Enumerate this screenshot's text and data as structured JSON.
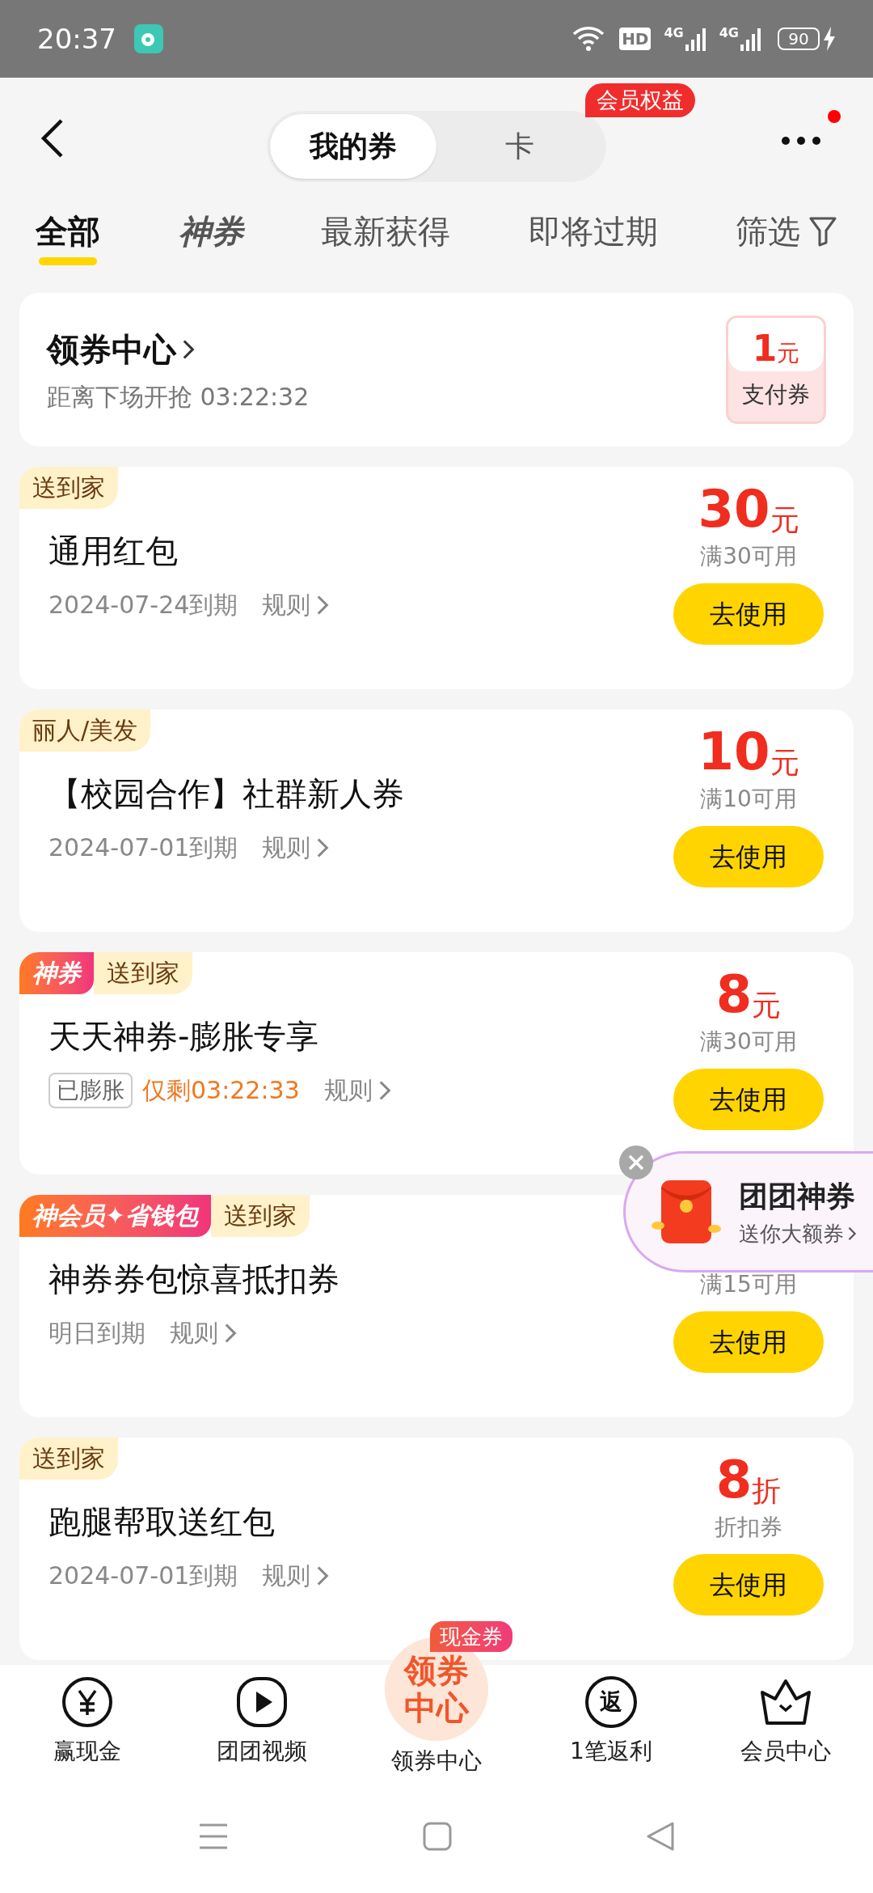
{
  "status_bar": {
    "time": "20:37",
    "hd": "HD",
    "network": [
      "4G",
      "4G"
    ],
    "battery": "90"
  },
  "header": {
    "segments": [
      {
        "label": "我的券",
        "selected": true
      },
      {
        "label": "卡",
        "selected": false
      }
    ],
    "badge": "会员权益",
    "more_dot": true
  },
  "filter_tabs": [
    {
      "label": "全部",
      "selected": true,
      "kind": "text"
    },
    {
      "label": "神券",
      "selected": false,
      "kind": "logo"
    },
    {
      "label": "最新获得",
      "selected": false,
      "kind": "text"
    },
    {
      "label": "即将过期",
      "selected": false,
      "kind": "text"
    },
    {
      "label": "筛选",
      "selected": false,
      "kind": "filter"
    }
  ],
  "center_card": {
    "title": "领券中心",
    "subtitle": "距离下场开抢 03:22:32",
    "coupon": {
      "amount": "1",
      "unit": "元",
      "label": "支付券"
    }
  },
  "coupons": [
    {
      "tags": [
        {
          "text": "送到家",
          "kind": "plain"
        }
      ],
      "title": "通用红包",
      "expiry": "2024-07-24到期",
      "rule": "规则",
      "amount": "30",
      "unit": "元",
      "condition": "满30可用",
      "button": "去使用"
    },
    {
      "tags": [
        {
          "text": "丽人/美发",
          "kind": "plain"
        }
      ],
      "title": "【校园合作】社群新人券",
      "expiry": "2024-07-01到期",
      "rule": "规则",
      "amount": "10",
      "unit": "元",
      "condition": "满10可用",
      "button": "去使用"
    },
    {
      "tags": [
        {
          "text": "神券",
          "kind": "gradient"
        },
        {
          "text": "送到家",
          "kind": "plain"
        }
      ],
      "title": "天天神券-膨胀专享",
      "status_tag": "已膨胀",
      "countdown": "仅剩03:22:33",
      "rule": "规则",
      "amount": "8",
      "unit": "元",
      "condition": "满30可用",
      "button": "去使用"
    },
    {
      "tags": [
        {
          "text": "神会员✦省钱包",
          "kind": "gradient"
        },
        {
          "text": "送到家",
          "kind": "plain"
        }
      ],
      "title": "神券券包惊喜抵扣券",
      "expiry": "明日到期",
      "rule": "规则",
      "condition": "满15可用",
      "button": "去使用"
    },
    {
      "tags": [
        {
          "text": "送到家",
          "kind": "plain"
        }
      ],
      "title": "跑腿帮取送红包",
      "expiry": "2024-07-01到期",
      "rule": "规则",
      "amount": "8",
      "unit": "折",
      "condition": "折扣券",
      "button": "去使用"
    }
  ],
  "popup": {
    "title": "团团神券",
    "subtitle": "送你大额券"
  },
  "bottom_nav": [
    {
      "label": "赢现金",
      "kind": "yen"
    },
    {
      "label": "团团视频",
      "kind": "play"
    },
    {
      "label": "领券中心",
      "kind": "center",
      "icon_text": [
        "领券",
        "中心"
      ],
      "badge": "现金券"
    },
    {
      "label": "1笔返利",
      "kind": "return",
      "icon_text": [
        "返"
      ]
    },
    {
      "label": "会员中心",
      "kind": "crown"
    }
  ]
}
